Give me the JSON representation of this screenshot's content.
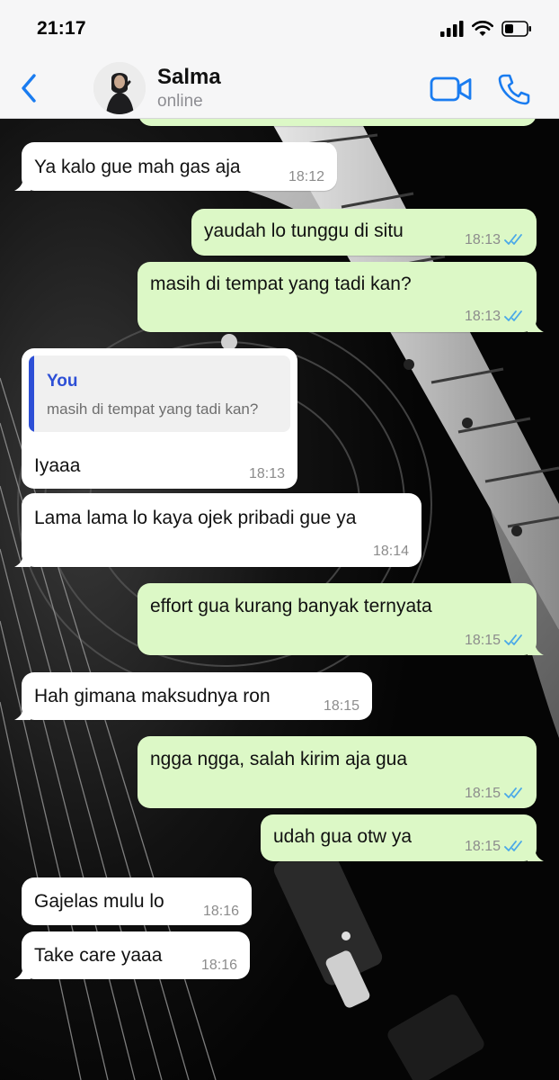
{
  "status_bar": {
    "time": "21:17"
  },
  "header": {
    "contact_name": "Salma",
    "contact_status": "online"
  },
  "colors": {
    "incoming_bubble": "#ffffff",
    "outgoing_bubble": "#dcf8c6",
    "accent": "#1a7cf0",
    "read_ticks": "#4aa8e8",
    "reply_accent": "#2d4fd6"
  },
  "icons": [
    "back-chevron-icon",
    "video-call-icon",
    "phone-call-icon",
    "signal-icon",
    "wifi-icon",
    "battery-icon",
    "double-check-icon"
  ],
  "messages": [
    {
      "direction": "incoming",
      "text": "Ya kalo gue mah gas aja",
      "time": "18:12"
    },
    {
      "direction": "outgoing",
      "text": "yaudah lo tunggu di situ",
      "time": "18:13",
      "read": true
    },
    {
      "direction": "outgoing",
      "text": "masih di tempat yang tadi kan?",
      "time": "18:13",
      "read": true
    },
    {
      "direction": "incoming",
      "reply_to": {
        "author": "You",
        "text": "masih di tempat yang tadi kan?"
      },
      "text": "Iyaaa",
      "time": "18:13"
    },
    {
      "direction": "incoming",
      "text": "Lama lama lo kaya ojek pribadi gue ya",
      "time": "18:14"
    },
    {
      "direction": "outgoing",
      "text": "effort gua kurang banyak ternyata",
      "time": "18:15",
      "read": true
    },
    {
      "direction": "incoming",
      "text": "Hah gimana maksudnya ron",
      "time": "18:15"
    },
    {
      "direction": "outgoing",
      "text": "ngga ngga, salah kirim aja gua",
      "time": "18:15",
      "read": true
    },
    {
      "direction": "outgoing",
      "text": "udah gua otw ya",
      "time": "18:15",
      "read": true
    },
    {
      "direction": "incoming",
      "text": "Gajelas mulu lo",
      "time": "18:16"
    },
    {
      "direction": "incoming",
      "text": "Take care yaaa",
      "time": "18:16"
    }
  ]
}
